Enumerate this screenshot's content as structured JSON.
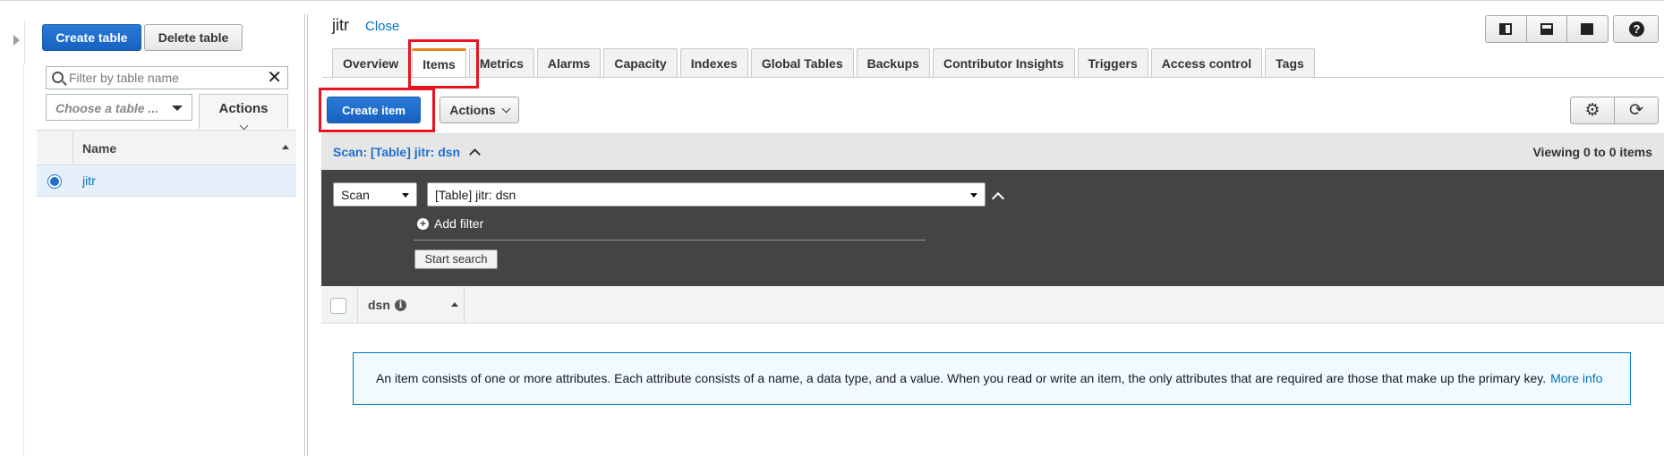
{
  "left_panel": {
    "create_table_label": "Create table",
    "delete_table_label": "Delete table",
    "filter_placeholder": "Filter by table name",
    "choose_table_placeholder": "Choose a table ...",
    "actions_label": "Actions",
    "column_name": "Name",
    "tables": [
      {
        "name": "jitr",
        "selected": true
      }
    ]
  },
  "header": {
    "table_title": "jitr",
    "close_label": "Close"
  },
  "tabs": [
    {
      "label": "Overview",
      "active": false
    },
    {
      "label": "Items",
      "active": true
    },
    {
      "label": "Metrics",
      "active": false
    },
    {
      "label": "Alarms",
      "active": false
    },
    {
      "label": "Capacity",
      "active": false
    },
    {
      "label": "Indexes",
      "active": false
    },
    {
      "label": "Global Tables",
      "active": false
    },
    {
      "label": "Backups",
      "active": false
    },
    {
      "label": "Contributor Insights",
      "active": false
    },
    {
      "label": "Triggers",
      "active": false
    },
    {
      "label": "Access control",
      "active": false
    },
    {
      "label": "Tags",
      "active": false
    }
  ],
  "toolbar": {
    "create_item_label": "Create item",
    "actions_label": "Actions"
  },
  "scan": {
    "summary_label": "Scan: [Table] jitr: dsn",
    "viewing_label": "Viewing 0 to 0 items",
    "mode_value": "Scan",
    "target_value": "[Table] jitr: dsn",
    "add_filter_label": "Add filter",
    "start_search_label": "Start search"
  },
  "results": {
    "columns": [
      {
        "label": "dsn"
      }
    ]
  },
  "info": {
    "text": "An item consists of one or more attributes. Each attribute consists of a name, a data type, and a value. When you read or write an item, the only attributes that are required are those that make up the primary key.",
    "link_label": "More info"
  },
  "colors": {
    "primary": "#1e6fd0",
    "link": "#0073bb",
    "highlight": "#e8131f",
    "active_tab_accent": "#e8821a",
    "dark_panel": "#444444"
  },
  "icons": {
    "collapse": "chevron-right-icon",
    "search": "search-icon",
    "clear": "close-icon",
    "help": "question-icon",
    "settings": "gear-icon",
    "refresh": "refresh-icon",
    "info": "info-icon",
    "add": "plus-circle-icon"
  }
}
